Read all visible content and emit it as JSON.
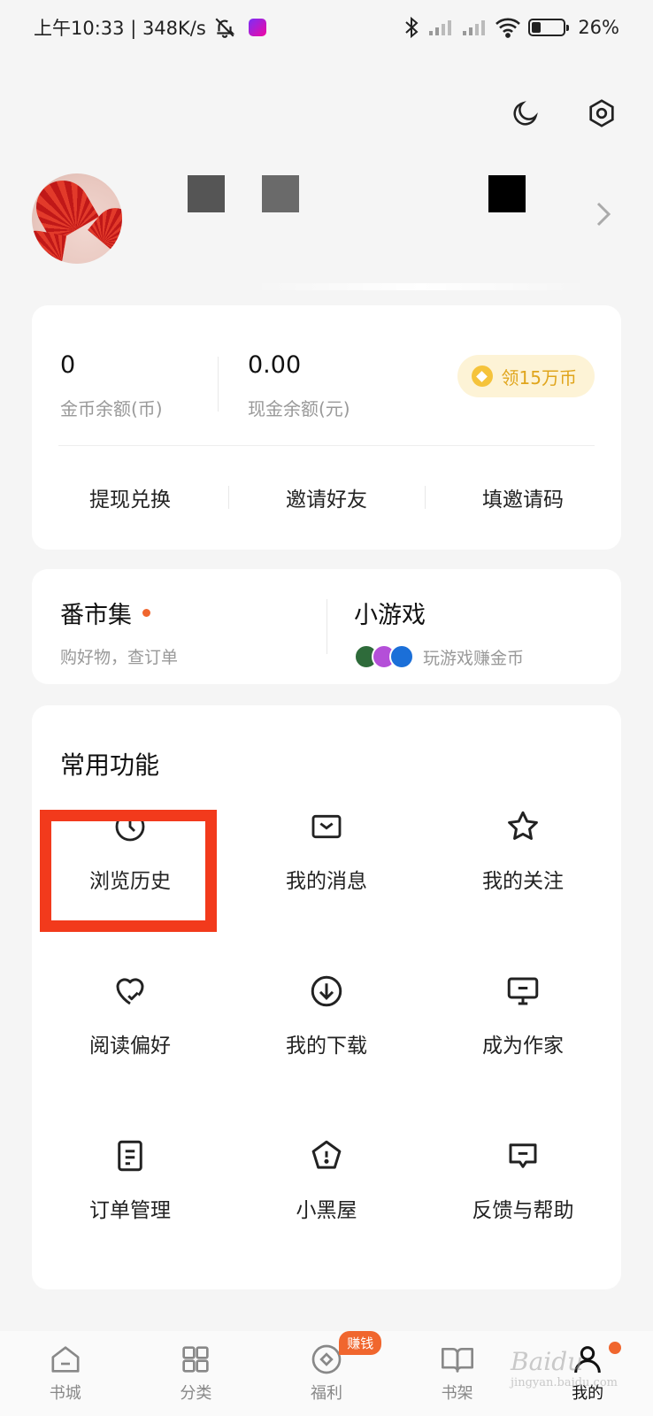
{
  "status_bar": {
    "left_text": "上午10:33 | 348K/s",
    "battery": "26%"
  },
  "wallet": {
    "coins_value": "0",
    "coins_label": "金币余额(币)",
    "cash_value": "0.00",
    "cash_label": "现金余额(元)",
    "claim_label": "领15万币",
    "actions": [
      "提现兑换",
      "邀请好友",
      "填邀请码"
    ]
  },
  "promo": {
    "market_title": "番市集",
    "market_sub": "购好物，查订单",
    "games_title": "小游戏",
    "games_sub": "玩游戏赚金币"
  },
  "features": {
    "title": "常用功能",
    "items": [
      {
        "label": "浏览历史",
        "icon": "clock-icon"
      },
      {
        "label": "我的消息",
        "icon": "mail-icon"
      },
      {
        "label": "我的关注",
        "icon": "star-icon"
      },
      {
        "label": "阅读偏好",
        "icon": "heart-check-icon"
      },
      {
        "label": "我的下载",
        "icon": "download-icon"
      },
      {
        "label": "成为作家",
        "icon": "monitor-icon"
      },
      {
        "label": "订单管理",
        "icon": "document-icon"
      },
      {
        "label": "小黑屋",
        "icon": "pentagon-alert-icon"
      },
      {
        "label": "反馈与帮助",
        "icon": "chat-alert-icon"
      }
    ],
    "highlighted_item": "浏览历史"
  },
  "tabbar": {
    "tabs": [
      {
        "label": "书城",
        "icon": "home-icon"
      },
      {
        "label": "分类",
        "icon": "grid-icon"
      },
      {
        "label": "福利",
        "icon": "coin-icon",
        "badge": "赚钱"
      },
      {
        "label": "书架",
        "icon": "book-icon"
      },
      {
        "label": "我的",
        "icon": "person-icon",
        "active": true
      }
    ]
  },
  "watermark": {
    "brand": "Baidu",
    "site": "jingyan.baidu.com"
  },
  "colors": {
    "accent": "#f0662e",
    "highlight": "#f23a1c",
    "coin": "#f5c33b"
  }
}
